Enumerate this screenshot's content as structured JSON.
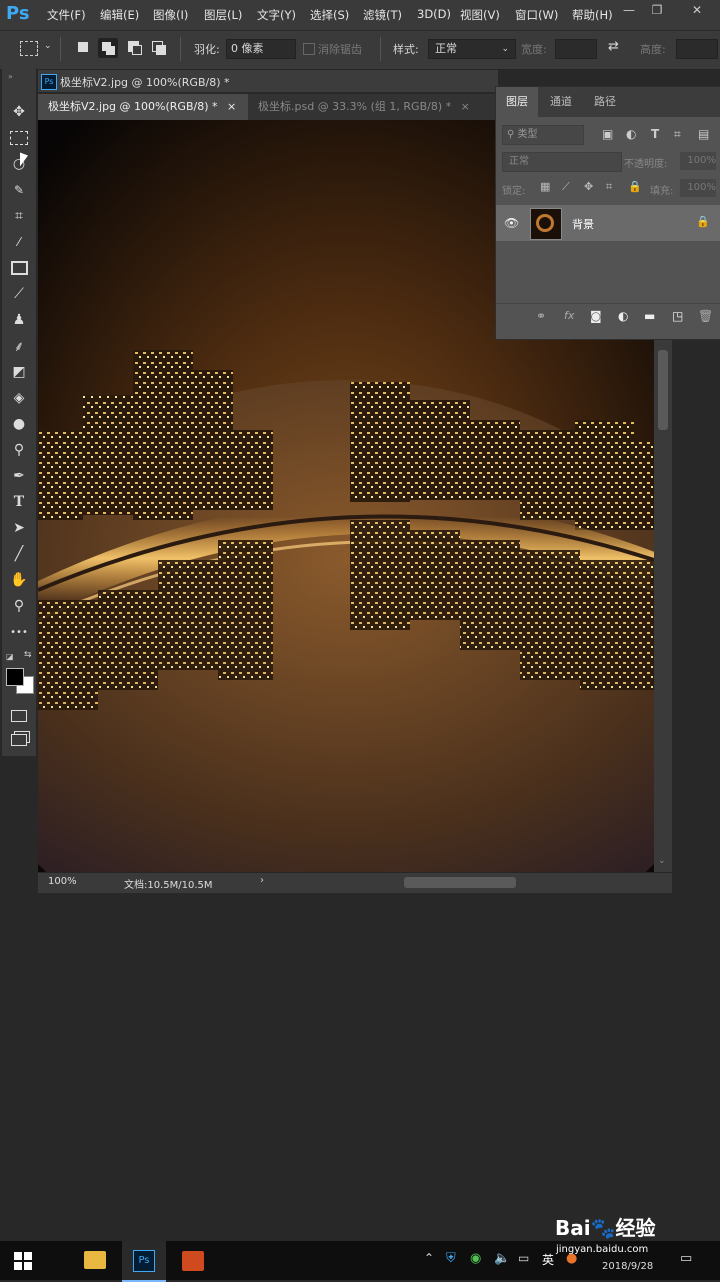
{
  "app": {
    "logo": "Ps"
  },
  "menu": [
    "文件(F)",
    "编辑(E)",
    "图像(I)",
    "图层(L)",
    "文字(Y)",
    "选择(S)",
    "滤镜(T)",
    "3D(D)",
    "视图(V)",
    "窗口(W)",
    "帮助(H)"
  ],
  "window_controls": {
    "minimize": "—",
    "restore": "❐",
    "close": "✕"
  },
  "options": {
    "feather_label": "羽化:",
    "feather_value": "0 像素",
    "antialias_label": "消除锯齿",
    "style_label": "样式:",
    "style_value": "正常",
    "width_label": "宽度:",
    "height_label": "高度:"
  },
  "window_title": "极坐标V2.jpg @ 100%(RGB/8) *",
  "doc_tabs": [
    {
      "label": "极坐标V2.jpg @ 100%(RGB/8) *",
      "close": "×",
      "active": true
    },
    {
      "label": "极坐标.psd @ 33.3% (组 1, RGB/8) *",
      "close": "×",
      "active": false
    }
  ],
  "status": {
    "zoom": "100%",
    "doc": "文档:10.5M/10.5M",
    "arrow": "›"
  },
  "layers_panel": {
    "tabs": [
      "图层",
      "通道",
      "路径"
    ],
    "filter_placeholder": "类型",
    "blend_mode": "正常",
    "opacity_label": "不透明度:",
    "opacity_value": "100%",
    "lock_label": "锁定:",
    "fill_label": "填充:",
    "fill_value": "100%",
    "layer_name": "背景",
    "footer_icons": [
      "link-icon",
      "fx-icon",
      "mask-icon",
      "adjustment-icon",
      "folder-icon",
      "new-layer-icon",
      "trash-icon"
    ],
    "fx_label": "fx"
  },
  "tools": [
    "move",
    "marquee",
    "lasso",
    "quick-select",
    "crop",
    "eyedropper",
    "frame",
    "brush",
    "stamp",
    "history-brush",
    "eraser",
    "bucket",
    "blur",
    "dodge",
    "pen",
    "type",
    "path-select",
    "line",
    "hand",
    "zoom",
    "more"
  ],
  "tool_text": {
    "type": "T",
    "more": "•••"
  },
  "taskbar": {
    "time": "2018/9/28",
    "ime": "英",
    "watermark_url": "jingyan.baidu.com",
    "watermark_text": "经验"
  },
  "colors": {
    "accent": "#3fa9f5",
    "panel": "#535353",
    "chrome": "#3a3a3a",
    "workspace": "#282828"
  }
}
